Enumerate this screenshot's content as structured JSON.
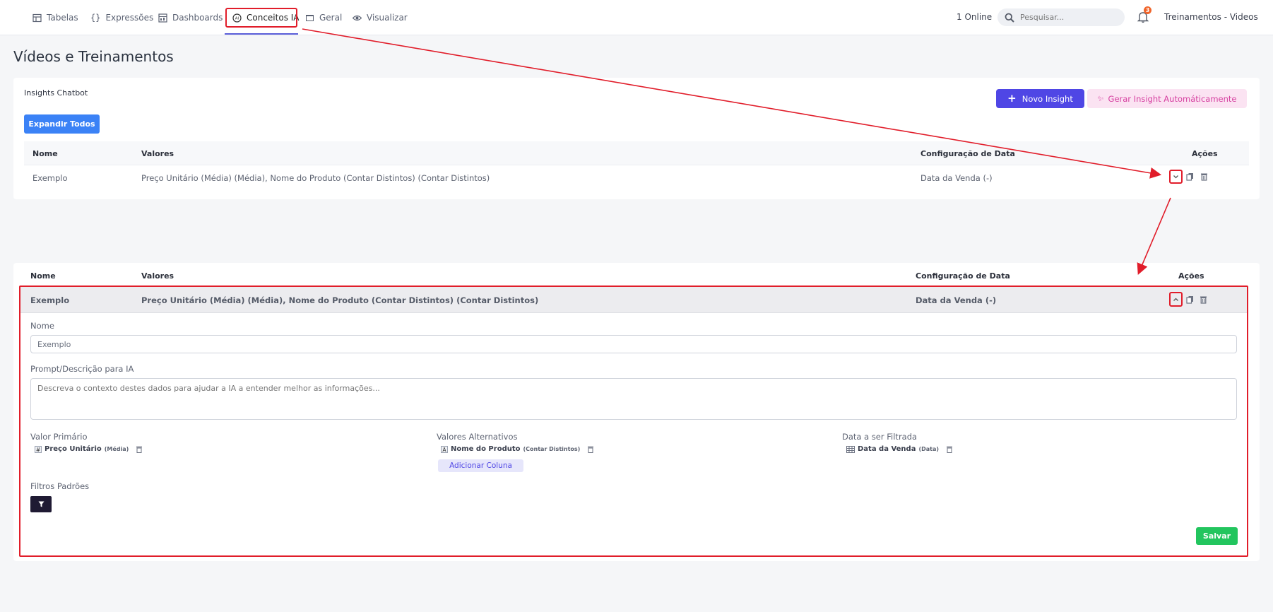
{
  "nav": {
    "tabs": [
      {
        "label": "Tabelas",
        "icon": "table-icon"
      },
      {
        "label": "Expressões",
        "icon": "braces-icon"
      },
      {
        "label": "Dashboards",
        "icon": "dashboard-icon"
      },
      {
        "label": "Conceitos IA",
        "icon": "ai-icon"
      },
      {
        "label": "Geral",
        "icon": "window-icon"
      },
      {
        "label": "Visualizar",
        "icon": "eye-icon"
      }
    ],
    "online": "1 Online",
    "search_placeholder": "Pesquisar...",
    "notification_count": "3",
    "workspace": "Treinamentos - Videos"
  },
  "page_title": "Vídeos e Treinamentos",
  "insights": {
    "label": "Insights Chatbot",
    "expand_all": "Expandir Todos",
    "new_insight": "Novo Insight",
    "auto_generate": "Gerar Insight Automáticamente",
    "columns": {
      "name": "Nome",
      "values": "Valores",
      "date_config": "Configuração de Data",
      "actions": "Ações"
    },
    "row": {
      "name": "Exemplo",
      "values": "Preço Unitário (Média) (Média), Nome do Produto (Contar Distintos) (Contar Distintos)",
      "date_config": "Data da Venda (-)"
    }
  },
  "editor": {
    "name_label": "Nome",
    "name_value": "Exemplo",
    "prompt_label": "Prompt/Descrição para IA",
    "prompt_placeholder": "Descreva o contexto destes dados para ajudar a IA a entender melhor as informações...",
    "primary_label": "Valor Primário",
    "primary_name": "Preço Unitário",
    "primary_agg": "(Média)",
    "alt_label": "Valores Alternativos",
    "alt_name": "Nome do Produto",
    "alt_agg": "(Contar Distintos)",
    "add_column": "Adicionar Coluna",
    "date_label": "Data a ser Filtrada",
    "date_name": "Data da Venda",
    "date_agg": "(Data)",
    "filters_label": "Filtros Padrões",
    "save": "Salvar"
  },
  "colors": {
    "accent": "#4f46e5",
    "highlight": "#e11d2a",
    "save": "#22c55e",
    "expand": "#3b82f6"
  }
}
